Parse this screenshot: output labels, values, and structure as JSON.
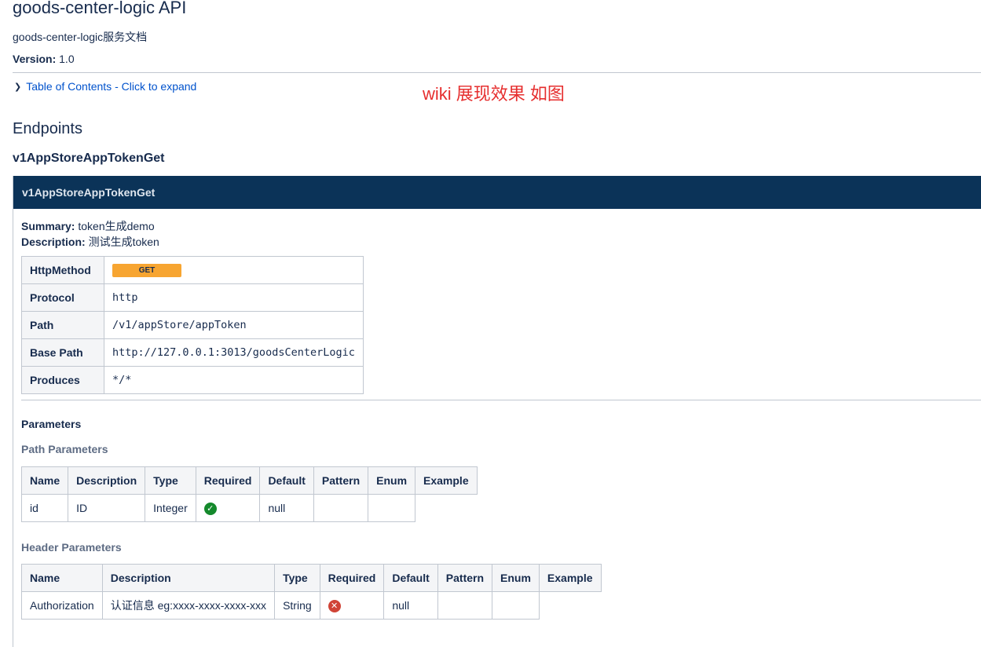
{
  "doc": {
    "title": "goods-center-logic API",
    "subtitle": "goods-center-logic服务文档",
    "version_label": "Version:",
    "version_value": "1.0",
    "toc_link": "Table of Contents - Click to expand",
    "toc_icon": "chevron-right-icon"
  },
  "annotation": "wiki 展现效果 如图",
  "endpoints": {
    "heading": "Endpoints",
    "name": "v1AppStoreAppTokenGet",
    "panel_title": "v1AppStoreAppTokenGet",
    "summary_label": "Summary:",
    "summary_value": "token生成demo",
    "description_label": "Description:",
    "description_value": "测试生成token",
    "info": [
      {
        "key": "HttpMethod",
        "value": "GET"
      },
      {
        "key": "Protocol",
        "value": "http"
      },
      {
        "key": "Path",
        "value": "/v1/appStore/appToken"
      },
      {
        "key": "Base Path",
        "value": "http://127.0.0.1:3013/goodsCenterLogic"
      },
      {
        "key": "Produces",
        "value": "*/*"
      }
    ],
    "method_color": "#f7a531",
    "panel_header_color": "#0b3358"
  },
  "parameters": {
    "heading": "Parameters",
    "path": {
      "heading": "Path Parameters",
      "columns": [
        "Name",
        "Description",
        "Type",
        "Required",
        "Default",
        "Pattern",
        "Enum",
        "Example"
      ],
      "rows": [
        {
          "name": "id",
          "description": "ID",
          "type": "Integer",
          "required_icon": "check-circle-icon",
          "default": "null",
          "pattern": "",
          "enum": ""
        }
      ]
    },
    "header": {
      "heading": "Header Parameters",
      "columns": [
        "Name",
        "Description",
        "Type",
        "Required",
        "Default",
        "Pattern",
        "Enum",
        "Example"
      ],
      "rows": [
        {
          "name": "Authorization",
          "description": "认证信息 eg:xxxx-xxxx-xxxx-xxx",
          "type": "String",
          "required_icon": "x-circle-icon",
          "default": "null",
          "pattern": "",
          "enum": ""
        }
      ]
    }
  }
}
